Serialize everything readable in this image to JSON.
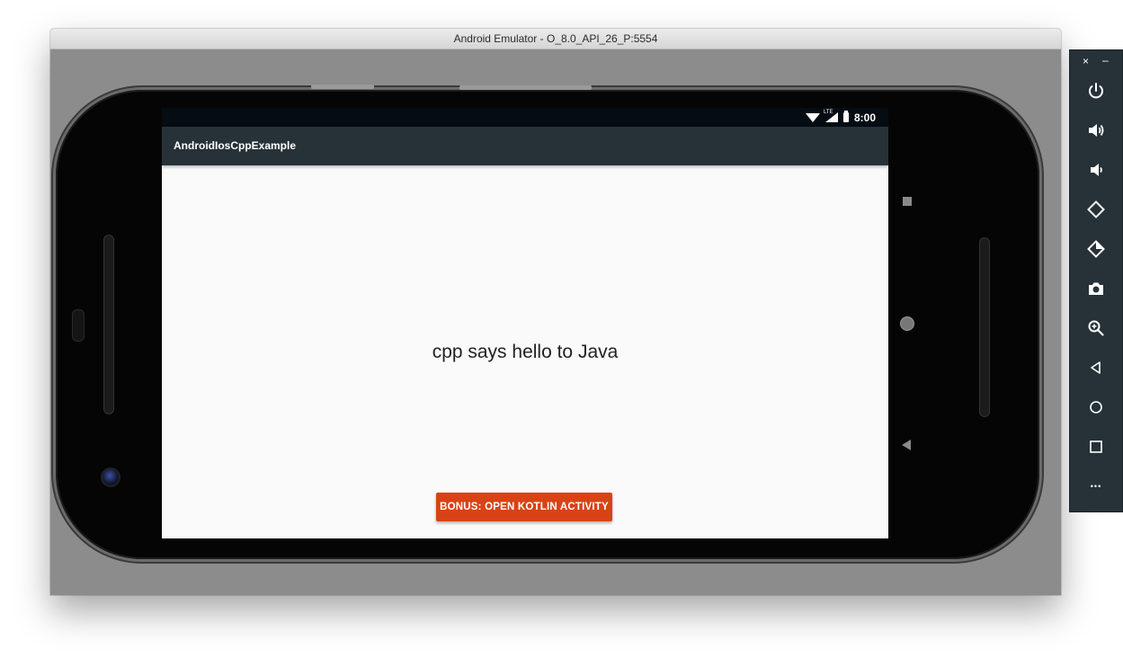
{
  "window": {
    "title": "Android Emulator - O_8.0_API_26_P:5554"
  },
  "statusbar": {
    "time": "8:00",
    "network_label": "LTE"
  },
  "app": {
    "title": "AndroidIosCppExample",
    "message": "cpp says hello to Java",
    "bonus_button_label": "BONUS: OPEN KOTLIN ACTIVITY"
  },
  "toolbar": {
    "close_label": "×",
    "minimize_label": "–",
    "more_label": "•••",
    "buttons": [
      "power-icon",
      "volume-up-icon",
      "volume-down-icon",
      "rotate-left-icon",
      "rotate-right-icon",
      "camera-icon",
      "zoom-icon",
      "back-icon",
      "home-icon",
      "overview-icon",
      "more-icon"
    ]
  },
  "colors": {
    "appbar": "#263238",
    "statusbar": "#050c12",
    "accent_button": "#d84315",
    "toolbar_bg": "#263238"
  }
}
